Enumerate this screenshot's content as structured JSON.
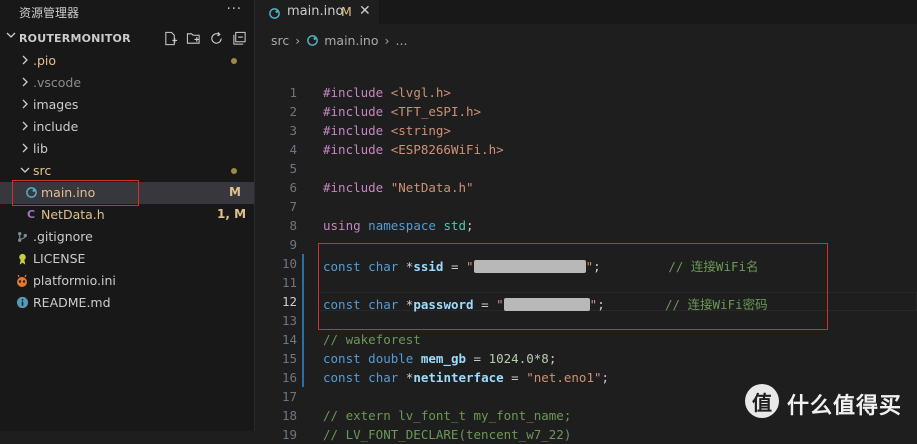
{
  "explorer": {
    "title": "资源管理器",
    "more": "···",
    "project": "ROUTERMONITOR"
  },
  "tree": [
    {
      "label": ".pio",
      "kind": "folder",
      "color": "#e2c08d",
      "dot": true
    },
    {
      "label": ".vscode",
      "kind": "folder",
      "color": "#8c8c8c",
      "dot": false
    },
    {
      "label": "images",
      "kind": "folder",
      "color": "#cccccc",
      "dot": false
    },
    {
      "label": "include",
      "kind": "folder",
      "color": "#cccccc",
      "dot": false
    },
    {
      "label": "lib",
      "kind": "folder",
      "color": "#cccccc",
      "dot": false
    },
    {
      "label": "src",
      "kind": "folder-open",
      "color": "#e2c08d",
      "dot": true
    },
    {
      "label": "main.ino",
      "kind": "file",
      "icon": "arduino-icon",
      "color": "#e2c08d",
      "badge": "M",
      "badge_color": "#e2c08d"
    },
    {
      "label": "NetData.h",
      "kind": "file",
      "icon": "c-header-icon",
      "color": "#e2c08d",
      "badge": "1, M",
      "badge_color": "#e2c08d"
    },
    {
      "label": ".gitignore",
      "kind": "file",
      "icon": "git-icon",
      "color": "#cccccc"
    },
    {
      "label": "LICENSE",
      "kind": "file",
      "icon": "license-icon",
      "color": "#cccccc"
    },
    {
      "label": "platformio.ini",
      "kind": "file",
      "icon": "platformio-icon",
      "color": "#cccccc"
    },
    {
      "label": "README.md",
      "kind": "file",
      "icon": "info-icon",
      "color": "#cccccc"
    }
  ],
  "tab": {
    "label": "main.ino",
    "modified": "M",
    "close": "✕"
  },
  "breadcrumb": {
    "folder": "src",
    "sep": "›",
    "file": "main.ino",
    "rest": "..."
  },
  "code_lines": [
    {
      "n": "1",
      "html": "<span class='pre'>#include</span> <span class='str'>&lt;lvgl.h&gt;</span>"
    },
    {
      "n": "2",
      "html": "<span class='pre'>#include</span> <span class='str'>&lt;TFT_eSPI.h&gt;</span>"
    },
    {
      "n": "3",
      "html": "<span class='pre'>#include</span> <span class='str'>&lt;string&gt;</span>"
    },
    {
      "n": "4",
      "html": "<span class='pre'>#include</span> <span class='str'>&lt;ESP8266WiFi.h&gt;</span>"
    },
    {
      "n": "5",
      "html": ""
    },
    {
      "n": "6",
      "html": "<span class='pre'>#include</span> <span class='str'>\"NetData.h\"</span>"
    },
    {
      "n": "7",
      "html": ""
    },
    {
      "n": "8",
      "html": "<span class='pre'>using</span> <span class='kw'>namespace</span> <span class='typ'>std</span>;"
    },
    {
      "n": "9",
      "html": ""
    },
    {
      "n": "10",
      "html": "<span class='kw'>const</span> <span class='kw'>char</span> *<span class='var'>ssid</span> = <span class='str'>\"<span class='mask' style='width:112px'></span>\"</span>;         <span class='cmt'>// 连接WiFi名</span>",
      "mod": true
    },
    {
      "n": "11",
      "html": "",
      "mod": true
    },
    {
      "n": "12",
      "html": "<span class='kw'>const</span> <span class='kw'>char</span> *<span class='var'>password</span> = <span class='str'>\"<span class='mask' style='width:86px'></span>\"</span>;        <span class='cmt'>// 连接WiFi密码</span>",
      "mod": true,
      "active": true
    },
    {
      "n": "13",
      "html": "",
      "mod": true
    },
    {
      "n": "14",
      "html": "<span class='cmt'>// wakeforest</span>",
      "mod": true
    },
    {
      "n": "15",
      "html": "<span class='kw'>const</span> <span class='kw'>double</span> <span class='var'>mem_gb</span> = <span class='num'>1024.0</span>*<span class='num'>8</span>;",
      "mod": true
    },
    {
      "n": "16",
      "html": "<span class='kw'>const</span> <span class='kw'>char</span> *<span class='var'>netinterface</span> = <span class='str'>\"net.eno1\"</span>;",
      "mod": true
    },
    {
      "n": "17",
      "html": ""
    },
    {
      "n": "18",
      "html": "<span class='cmt'>// extern lv_font_t my_font_name;</span>"
    },
    {
      "n": "19",
      "html": "<span class='cmt'>// LV_FONT_DECLARE(tencent_w7_22)</span>"
    }
  ],
  "watermark": {
    "logo": "值",
    "text": "什么值得买"
  }
}
